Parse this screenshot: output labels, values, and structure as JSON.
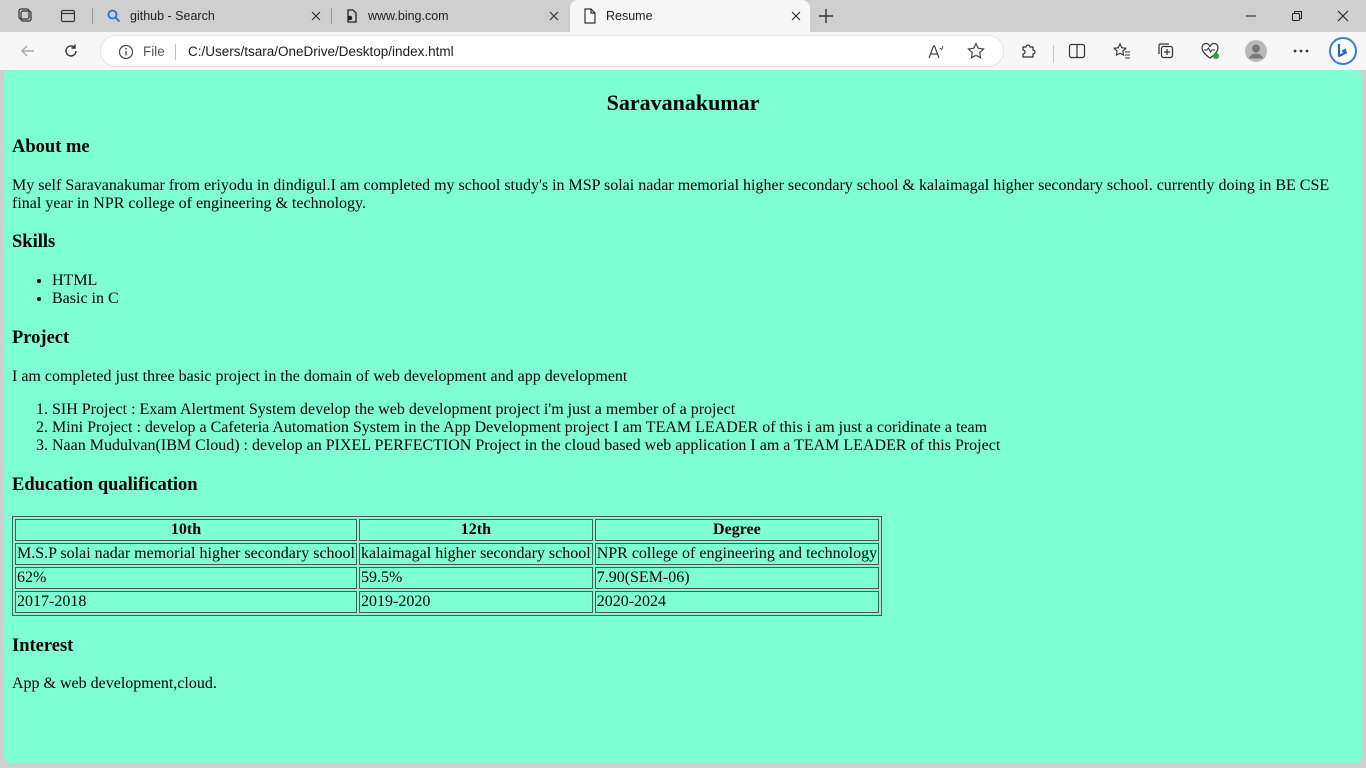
{
  "browser": {
    "tabs": [
      {
        "title": "github - Search",
        "icon": "search-icon"
      },
      {
        "title": "www.bing.com",
        "icon": "bing-page-icon"
      },
      {
        "title": "Resume",
        "icon": "document-icon",
        "active": true
      }
    ],
    "address": {
      "scheme_label": "File",
      "url": "C:/Users/tsara/OneDrive/Desktop/index.html"
    },
    "read_aloud_label": "Aᵀ"
  },
  "page": {
    "name": "Saravanakumar",
    "about": {
      "heading": "About me",
      "text": "My self Saravanakumar from eriyodu in dindigul.I am completed my school study's in MSP solai nadar memorial higher secondary school & kalaimagal higher secondary school. currently doing in BE CSE final year in NPR college of engineering & technology."
    },
    "skills": {
      "heading": "Skills",
      "items": [
        "HTML",
        "Basic in C"
      ]
    },
    "project": {
      "heading": "Project",
      "intro": "I am completed just three basic project in the domain of web development and app development",
      "items": [
        "SIH Project : Exam Alertment System develop the web development project i'm just a member of a project",
        "Mini Project : develop a Cafeteria Automation System in the App Development project I am TEAM LEADER of this i am just a coridinate a team",
        "Naan Mudulvan(IBM Cloud) : develop an PIXEL PERFECTION Project in the cloud based web application I am a TEAM LEADER of this Project"
      ]
    },
    "education": {
      "heading": "Education qualification",
      "headers": [
        "10th",
        "12th",
        "Degree"
      ],
      "rows": [
        [
          "M.S.P solai nadar memorial higher secondary school",
          "kalaimagal higher secondary school",
          "NPR college of engineering and technology"
        ],
        [
          "62%",
          "59.5%",
          "7.90(SEM-06)"
        ],
        [
          "2017-2018",
          "2019-2020",
          "2020-2024"
        ]
      ]
    },
    "interest": {
      "heading": "Interest",
      "text": "App & web development,cloud."
    },
    "background_color": "#7fffd4"
  }
}
